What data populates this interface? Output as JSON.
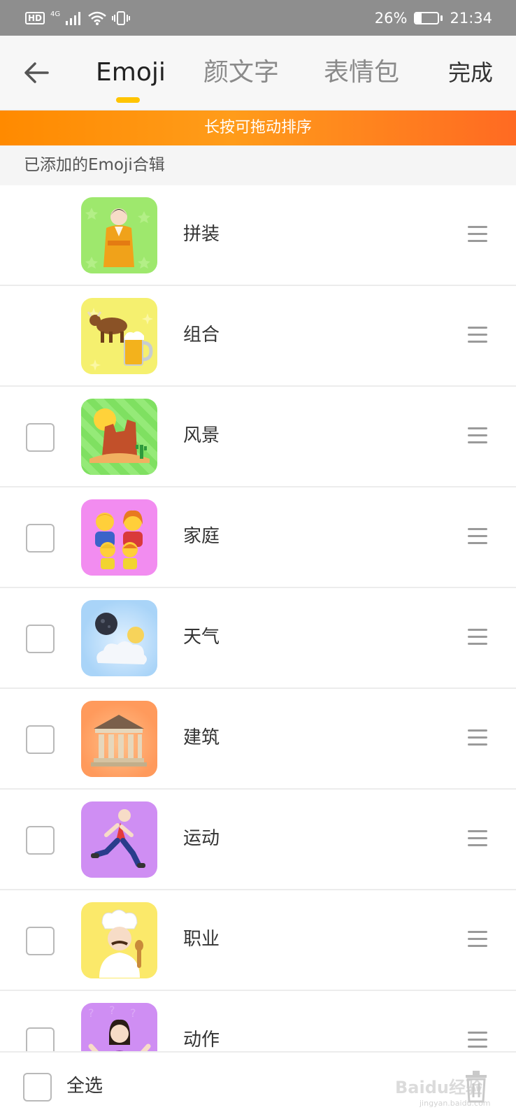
{
  "status_bar": {
    "hd": "HD",
    "network": "4G",
    "battery_percent": "26%",
    "battery_level": 0.26,
    "time": "21:34"
  },
  "nav": {
    "tabs": [
      {
        "label": "Emoji",
        "active": true
      },
      {
        "label": "颜文字",
        "active": false
      },
      {
        "label": "表情包",
        "active": false
      }
    ],
    "done_label": "完成",
    "indicator_color": "#ffc400"
  },
  "banner": {
    "text": "长按可拖动排序",
    "gradient": [
      "#ff8a00",
      "#ff6a22"
    ]
  },
  "section": {
    "title": "已添加的Emoji合辑"
  },
  "collections": [
    {
      "label": "拼装",
      "checkbox": false,
      "thumb_color": "#9ee86d",
      "icon": "kimono-person-icon"
    },
    {
      "label": "组合",
      "checkbox": false,
      "thumb_color": "#f5f06f",
      "icon": "cow-beer-icon"
    },
    {
      "label": "风景",
      "checkbox": true,
      "thumb_color": "#87e56a",
      "icon": "desert-landscape-icon"
    },
    {
      "label": "家庭",
      "checkbox": true,
      "thumb_color": "#f28cf0",
      "icon": "family-icon"
    },
    {
      "label": "天气",
      "checkbox": true,
      "thumb_color": "#a9d4f8",
      "icon": "moon-cloud-icon"
    },
    {
      "label": "建筑",
      "checkbox": true,
      "thumb_color": "#ff9a5c",
      "icon": "classical-building-icon"
    },
    {
      "label": "运动",
      "checkbox": true,
      "thumb_color": "#cf8ef3",
      "icon": "runner-icon"
    },
    {
      "label": "职业",
      "checkbox": true,
      "thumb_color": "#fbe96a",
      "icon": "chef-icon"
    },
    {
      "label": "动作",
      "checkbox": true,
      "thumb_color": "#cf8ef3",
      "icon": "shrug-woman-icon"
    }
  ],
  "bottom_bar": {
    "select_all_label": "全选",
    "watermark": "Baidu经验",
    "watermark_sub": "jingyan.baidu.com"
  }
}
